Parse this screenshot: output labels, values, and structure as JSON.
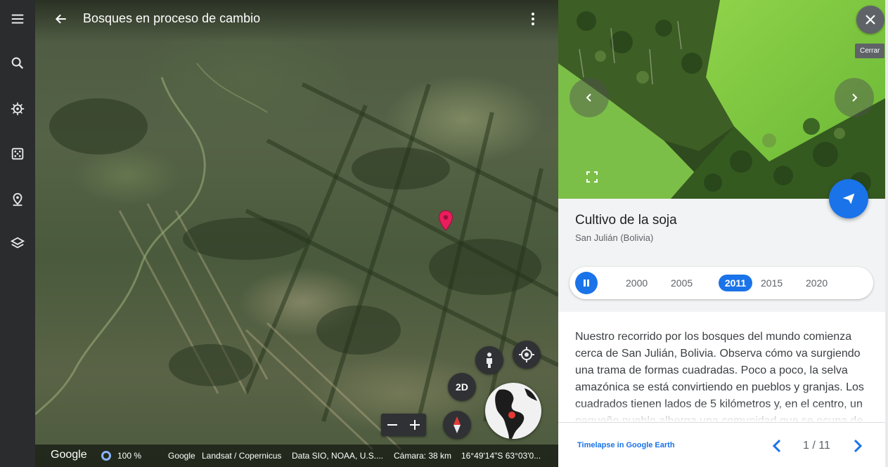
{
  "rail": {
    "items": [
      {
        "icon": "menu-icon"
      },
      {
        "icon": "search-icon"
      },
      {
        "icon": "voyager-icon"
      },
      {
        "icon": "feeling-lucky-icon"
      },
      {
        "icon": "projects-icon"
      },
      {
        "icon": "map-style-icon"
      }
    ]
  },
  "map": {
    "title": "Bosques en proceso de cambio",
    "controls": {
      "two_d_label": "2D"
    }
  },
  "status": {
    "logo": "Google",
    "percent": "100 %",
    "attribution_1": "Google",
    "attribution_2": "Landsat / Copernicus",
    "attribution_3": "Data SIO, NOAA, U.S....",
    "camera": "Cámara: 38 km",
    "coords": "16°49'14\"S 63°03'0..."
  },
  "panel": {
    "close_tooltip": "Cerrar",
    "title": "Cultivo de la soja",
    "subtitle": "San Julián (Bolivia)",
    "timeline": {
      "years": [
        "2000",
        "2005",
        "2011",
        "2015",
        "2020"
      ],
      "active": "2011"
    },
    "description": "Nuestro recorrido por los bosques del mundo comienza cerca de San Julián, Bolivia. Observa cómo va surgiendo una trama de formas cuadradas. Poco a poco, la selva amazónica se está convirtiendo en pueblos y granjas. Los cuadrados tienen lados de 5 kilómetros y, en el centro, un pequeño pueblo alberga una comunidad que se ocupa de",
    "footer_link": "Timelapse in Google Earth",
    "pager": "1 / 11"
  },
  "colors": {
    "accent": "#1a73e8",
    "rail_bg": "#2b2c2e",
    "marker": "#ea1d5d"
  }
}
